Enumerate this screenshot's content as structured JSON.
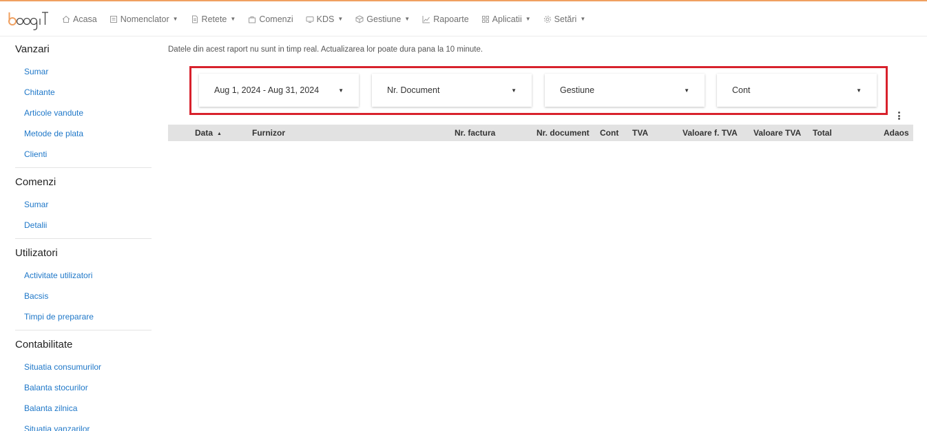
{
  "brand": {
    "logo_text": "boogiT",
    "accent": "#f0a060",
    "highlight": "#d8212c",
    "link": "#1e77c8"
  },
  "nav": [
    {
      "label": "Acasa",
      "icon": "home-icon",
      "has_caret": false
    },
    {
      "label": "Nomenclator",
      "icon": "list-icon",
      "has_caret": true
    },
    {
      "label": "Retete",
      "icon": "document-icon",
      "has_caret": true
    },
    {
      "label": "Comenzi",
      "icon": "bag-icon",
      "has_caret": false
    },
    {
      "label": "KDS",
      "icon": "monitor-icon",
      "has_caret": true
    },
    {
      "label": "Gestiune",
      "icon": "box-icon",
      "has_caret": true
    },
    {
      "label": "Rapoarte",
      "icon": "chart-icon",
      "has_caret": false
    },
    {
      "label": "Aplicatii",
      "icon": "grid-icon",
      "has_caret": true
    },
    {
      "label": "Setări",
      "icon": "gear-icon",
      "has_caret": true
    }
  ],
  "sidebar": [
    {
      "title": "Vanzari",
      "items": [
        "Sumar",
        "Chitante",
        "Articole vandute",
        "Metode de plata",
        "Clienti"
      ]
    },
    {
      "title": "Comenzi",
      "items": [
        "Sumar",
        "Detalii"
      ]
    },
    {
      "title": "Utilizatori",
      "items": [
        "Activitate utilizatori",
        "Bacsis",
        "Timpi de preparare"
      ]
    },
    {
      "title": "Contabilitate",
      "items": [
        "Situatia consumurilor",
        "Balanta stocurilor",
        "Balanta zilnica",
        "Situatia vanzarilor"
      ]
    }
  ],
  "main": {
    "info": "Datele din acest raport nu sunt in timp real. Actualizarea lor poate dura pana la 10 minute.",
    "filters": [
      "Aug 1, 2024 - Aug 31, 2024",
      "Nr. Document",
      "Gestiune",
      "Cont"
    ],
    "columns": [
      "Data",
      "Furnizor",
      "Nr. factura",
      "Nr. document",
      "Cont",
      "TVA",
      "Valoare f. TVA",
      "Valoare TVA",
      "Total",
      "Adaos"
    ],
    "sort_indicator": "▲"
  }
}
